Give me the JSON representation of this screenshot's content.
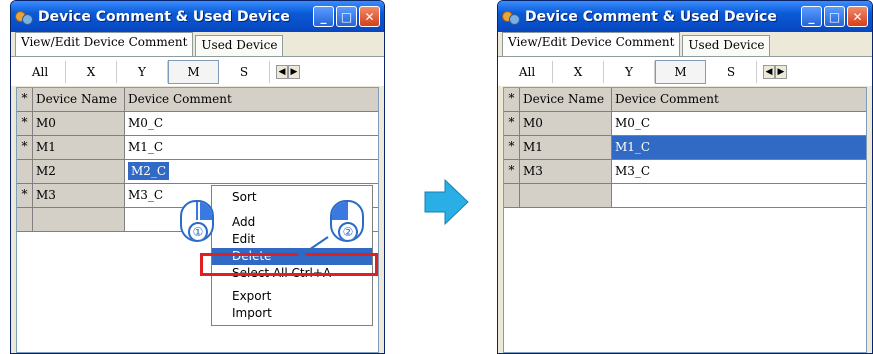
{
  "window_title": "Device Comment & Used Device",
  "tabs": [
    "View/Edit Device Comment",
    "Used Device"
  ],
  "subtabs": [
    "All",
    "X",
    "Y",
    "M",
    "S"
  ],
  "grid_header": {
    "mark": "*",
    "name": "Device Name",
    "comment": "Device Comment"
  },
  "left_rows": [
    {
      "mark": "*",
      "name": "M0",
      "comment": "M0_C"
    },
    {
      "mark": "*",
      "name": "M1",
      "comment": "M1_C"
    },
    {
      "mark": "",
      "name": "M2",
      "comment": "M2_C"
    },
    {
      "mark": "*",
      "name": "M3",
      "comment": "M3_C"
    },
    {
      "mark": "",
      "name": "",
      "comment": ""
    }
  ],
  "right_rows": [
    {
      "mark": "*",
      "name": "M0",
      "comment": "M0_C"
    },
    {
      "mark": "*",
      "name": "M1",
      "comment": "M1_C"
    },
    {
      "mark": "*",
      "name": "M3",
      "comment": "M3_C"
    },
    {
      "mark": "",
      "name": "",
      "comment": ""
    }
  ],
  "context_menu": [
    "Sort",
    "",
    "Add",
    "Edit",
    "Delete",
    "Select All  Ctrl+A",
    "",
    "Export",
    "Import"
  ],
  "callouts": [
    "①",
    "②"
  ],
  "colors": {
    "title": "#0a5ad6",
    "highlight": "#316ac5",
    "redbox": "#e02020",
    "arrow": "#29aee6"
  }
}
